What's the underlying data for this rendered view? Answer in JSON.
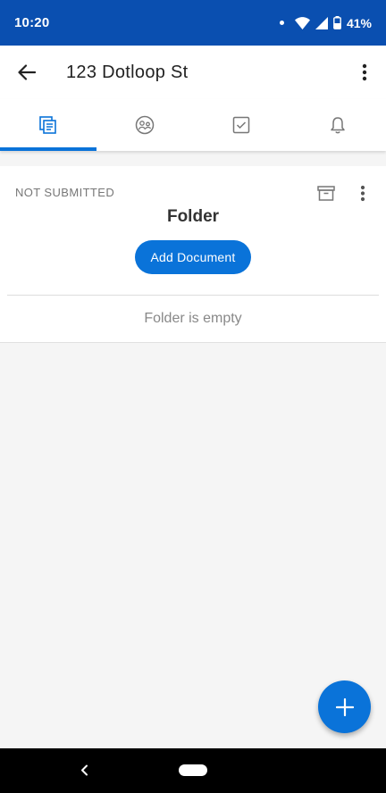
{
  "status_bar": {
    "time": "10:20",
    "battery": "41%",
    "icons": [
      "notification-dot-icon",
      "wifi-icon",
      "signal-icon",
      "battery-icon"
    ]
  },
  "app_bar": {
    "title": "123 Dotloop St",
    "back_icon": "arrow-left-icon",
    "menu_icon": "more-vert-icon"
  },
  "tabs": [
    {
      "icon": "documents-icon",
      "active": true
    },
    {
      "icon": "people-icon",
      "active": false
    },
    {
      "icon": "tasks-icon",
      "active": false
    },
    {
      "icon": "bell-icon",
      "active": false
    }
  ],
  "folder": {
    "status": "NOT SUBMITTED",
    "name": "Folder",
    "add_button_label": "Add Document",
    "empty_message": "Folder is empty"
  },
  "colors": {
    "brand_blue": "#0a4fb0",
    "accent_blue": "#0a73d9"
  }
}
